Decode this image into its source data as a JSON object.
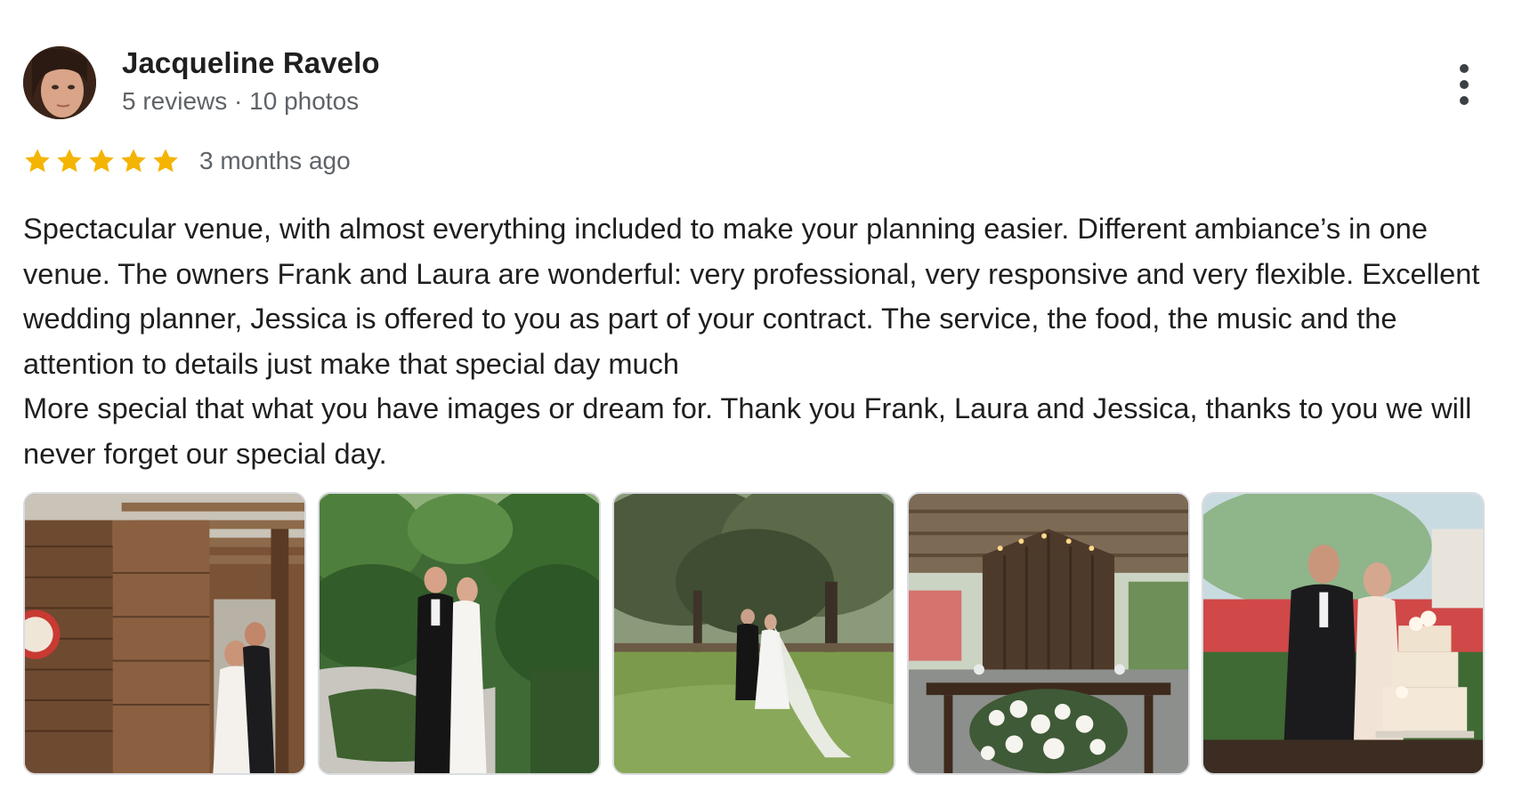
{
  "review": {
    "author": {
      "name": "Jacqueline Ravelo",
      "meta": "5 reviews · 10 photos"
    },
    "rating": {
      "stars": 5,
      "max_stars": 5,
      "star_color": "#f4b400",
      "date": "3 months ago"
    },
    "text": "Spectacular venue, with almost everything included to make your planning easier. Different ambiance’s in one venue. The owners Frank and Laura are wonderful: very professional, very responsive and very flexible. Excellent wedding planner, Jessica is offered to you as part of your contract. The service, the food, the music and the attention to details just make that special day much\nMore special that what you have images or dream for. Thank you Frank, Laura and Jessica, thanks to you we will never forget our special day.",
    "photos_count": 5,
    "more_options_icon": "more-vert-icon"
  }
}
